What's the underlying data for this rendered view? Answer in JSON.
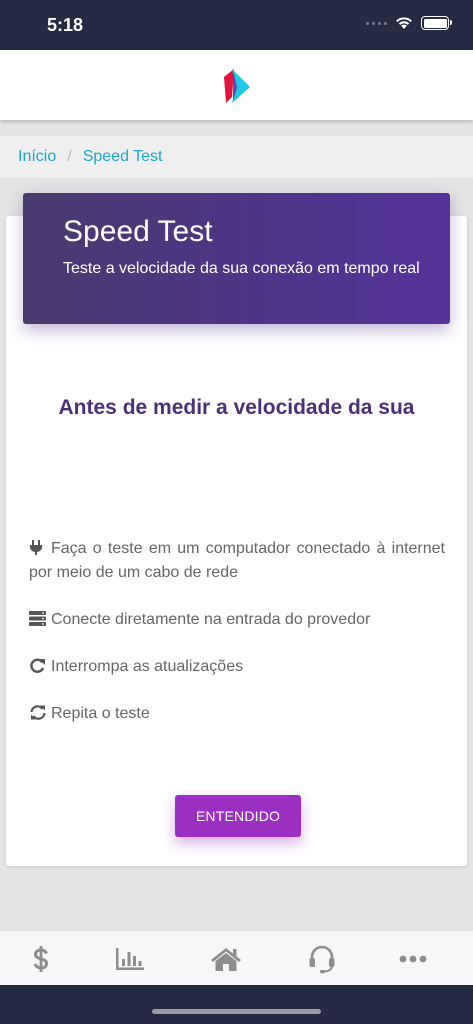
{
  "status_bar": {
    "time": "5:18"
  },
  "breadcrumb": {
    "items": [
      "Início",
      "Speed Test"
    ],
    "separator": "/"
  },
  "hero": {
    "title": "Speed Test",
    "subtitle": "Teste a velocidade da sua conexão em tempo real"
  },
  "main": {
    "heading": "Antes de medir a velocidade da sua",
    "tips": [
      {
        "icon": "plug-icon",
        "text": "Faça o teste em um computador conectado à internet por meio de um cabo de rede"
      },
      {
        "icon": "server-icon",
        "text": "Conecte diretamente na entrada do provedor"
      },
      {
        "icon": "redo-icon",
        "text": "Interrompa as atualizações"
      },
      {
        "icon": "sync-icon",
        "text": "Repita o teste"
      }
    ],
    "button_label": "ENTENDIDO"
  },
  "tabbar": {
    "items": [
      "dollar-icon",
      "chart-icon",
      "home-icon",
      "headset-icon",
      "more-icon"
    ]
  },
  "colors": {
    "accent_purple": "#9b2fc1",
    "heading_purple": "#4d3176",
    "link_cyan": "#1aa7c9",
    "status_bar": "#262a42",
    "icon_gray": "#8d8d8d"
  }
}
